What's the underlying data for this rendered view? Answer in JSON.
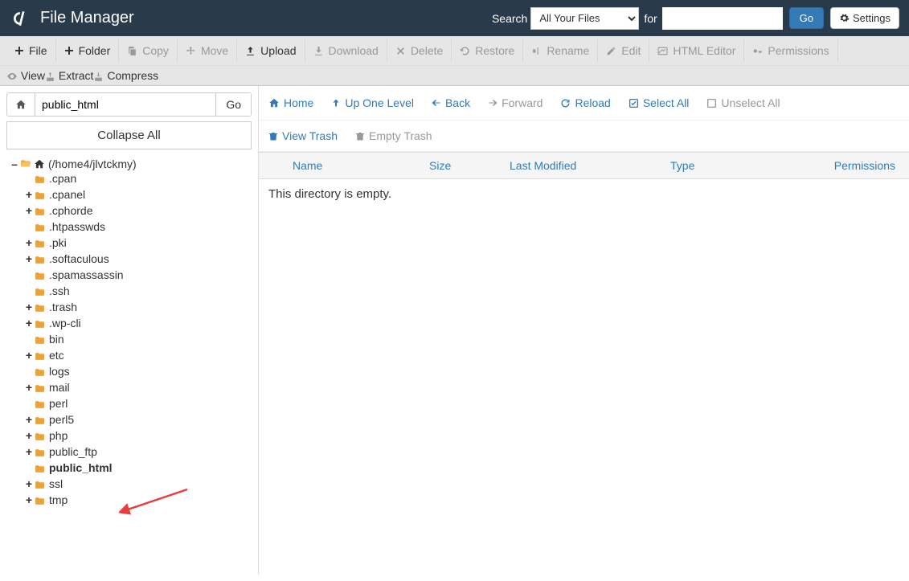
{
  "header": {
    "title": "File Manager",
    "search_label": "Search",
    "for_label": "for",
    "search_select_value": "All Your Files",
    "search_input_value": "",
    "go_label": "Go",
    "settings_label": "Settings"
  },
  "toolbar": {
    "file": "File",
    "folder": "Folder",
    "copy": "Copy",
    "move": "Move",
    "upload": "Upload",
    "download": "Download",
    "delete": "Delete",
    "restore": "Restore",
    "rename": "Rename",
    "edit": "Edit",
    "html_editor": "HTML Editor",
    "permissions": "Permissions",
    "view": "View",
    "extract": "Extract",
    "compress": "Compress"
  },
  "sidebar": {
    "location_value": "public_html",
    "go_label": "Go",
    "collapse_all": "Collapse All",
    "root_label": "(/home4/jlvtckmy)",
    "tree": [
      {
        "name": ".cpan",
        "expandable": false
      },
      {
        "name": ".cpanel",
        "expandable": true
      },
      {
        "name": ".cphorde",
        "expandable": true
      },
      {
        "name": ".htpasswds",
        "expandable": false
      },
      {
        "name": ".pki",
        "expandable": true
      },
      {
        "name": ".softaculous",
        "expandable": true
      },
      {
        "name": ".spamassassin",
        "expandable": false
      },
      {
        "name": ".ssh",
        "expandable": false
      },
      {
        "name": ".trash",
        "expandable": true
      },
      {
        "name": ".wp-cli",
        "expandable": true
      },
      {
        "name": "bin",
        "expandable": false
      },
      {
        "name": "etc",
        "expandable": true
      },
      {
        "name": "logs",
        "expandable": false
      },
      {
        "name": "mail",
        "expandable": true
      },
      {
        "name": "perl",
        "expandable": false
      },
      {
        "name": "perl5",
        "expandable": true
      },
      {
        "name": "php",
        "expandable": true
      },
      {
        "name": "public_ftp",
        "expandable": true
      },
      {
        "name": "public_html",
        "expandable": false,
        "selected": true
      },
      {
        "name": "ssl",
        "expandable": true
      },
      {
        "name": "tmp",
        "expandable": true
      }
    ]
  },
  "content": {
    "home": "Home",
    "up_one_level": "Up One Level",
    "back": "Back",
    "forward": "Forward",
    "reload": "Reload",
    "select_all": "Select All",
    "unselect_all": "Unselect All",
    "view_trash": "View Trash",
    "empty_trash": "Empty Trash",
    "columns": {
      "name": "Name",
      "size": "Size",
      "last_modified": "Last Modified",
      "type": "Type",
      "permissions": "Permissions"
    },
    "empty_message": "This directory is empty."
  }
}
